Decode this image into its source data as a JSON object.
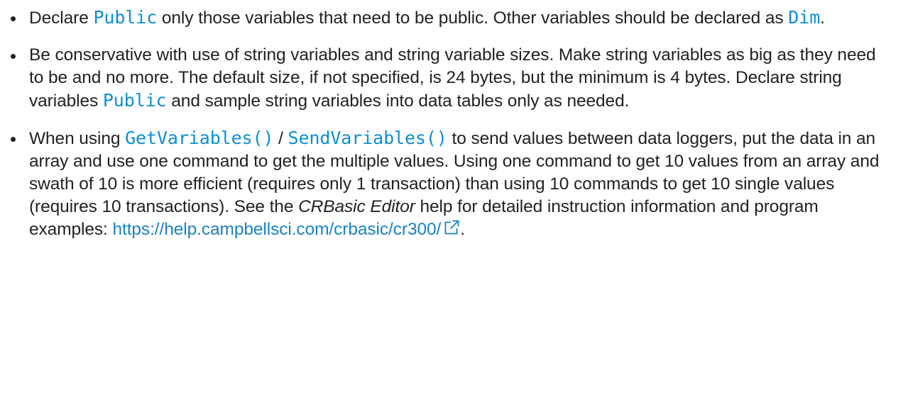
{
  "bullets": [
    {
      "t1": "Declare ",
      "code1": "Public",
      "t2": " only those variables that need to be public. Other variables should be declared as ",
      "code2": "Dim",
      "t3": "."
    },
    {
      "t1": "Be conservative with use of string variables and string variable sizes. Make string variables as big as they need to be and no more. The default size, if not specified, is 24 bytes, but the minimum is 4 bytes. Declare string variables ",
      "code1": "Public",
      "t2": " and sample string variables into data tables only as needed."
    },
    {
      "t1": "When using ",
      "code1": "GetVariables()",
      "sep": " / ",
      "code2": "SendVariables()",
      "t2": " to send values between data loggers, put the data in an array and use one command to get the multiple values. Using one command to get 10 values from an array and swath of 10 is more efficient (requires only 1 transaction) than using 10 commands to get 10 single values (requires 10 transactions). See the ",
      "italic": "CRBasic Editor",
      "t3": " help for detailed instruction information and program examples: ",
      "link": "https://help.campbellsci.com/crbasic/cr300/",
      "t4": "."
    }
  ],
  "colors": {
    "code": "#0b8fd6",
    "link": "#1a82c4",
    "text": "#222222"
  },
  "icons": {
    "external_link": "external-link-icon"
  }
}
